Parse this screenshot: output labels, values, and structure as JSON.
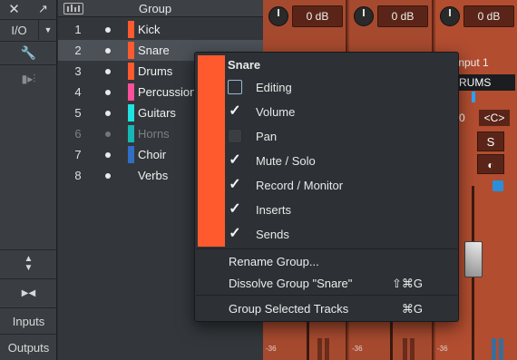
{
  "toolbar": {
    "io_label": "I/O",
    "inputs_label": "Inputs",
    "outputs_label": "Outputs"
  },
  "tracklist": {
    "header": "Group",
    "tracks": [
      {
        "num": "1",
        "name": "Kick",
        "color": "#ff5a2e",
        "dim": false
      },
      {
        "num": "2",
        "name": "Snare",
        "color": "#ff5a2e",
        "dim": false
      },
      {
        "num": "3",
        "name": "Drums",
        "color": "#ff5a2e",
        "dim": false
      },
      {
        "num": "4",
        "name": "Percussion",
        "color": "#ff4f9a",
        "dim": false
      },
      {
        "num": "5",
        "name": "Guitars",
        "color": "#1fe3e0",
        "dim": false
      },
      {
        "num": "6",
        "name": "Horns",
        "color": "#15b8b4",
        "dim": true
      },
      {
        "num": "7",
        "name": "Choir",
        "color": "#2f6ec4",
        "dim": false
      },
      {
        "num": "8",
        "name": "Verbs",
        "color": "",
        "dim": false
      }
    ]
  },
  "mixer": {
    "db1": "0 dB",
    "db2": "0 dB",
    "db3": "0 dB",
    "input_label": "Input 1",
    "bus_label": "RUMS",
    "pan_label": "<C>",
    "pan_val": "0",
    "solo_label": "S",
    "scale_36": "-36"
  },
  "menu": {
    "group_name": "Snare",
    "items": [
      {
        "label": "Editing",
        "checked": false,
        "style": "empty"
      },
      {
        "label": "Volume",
        "checked": true
      },
      {
        "label": "Pan",
        "checked": false,
        "style": "dark"
      },
      {
        "label": "Mute / Solo",
        "checked": true
      },
      {
        "label": "Record / Monitor",
        "checked": true
      },
      {
        "label": "Inserts",
        "checked": true
      },
      {
        "label": "Sends",
        "checked": true
      }
    ],
    "rename": "Rename Group...",
    "dissolve": "Dissolve Group \"Snare\"",
    "dissolve_shortcut": "⇧⌘G",
    "group_selected": "Group Selected Tracks",
    "group_selected_shortcut": "⌘G",
    "accent": "#ff5a2e"
  }
}
